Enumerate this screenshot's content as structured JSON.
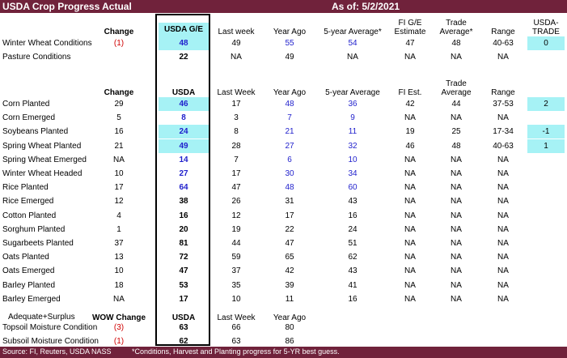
{
  "title": "USDA Crop Progress Actual",
  "as_of": "As of:   5/2/2021",
  "footer": {
    "source": "Source: FI, Reuters, USDA NASS",
    "note": "*Conditions, Harvest and Planting progress for 5-YR best guess."
  },
  "colors": {
    "header_bg": "#70223b",
    "highlight": "#a6f2f5",
    "blue": "#1f1fcc",
    "red": "#d00000"
  },
  "section1": {
    "headers": {
      "change": "Change",
      "usda": "USDA G/E",
      "last_week": "Last week",
      "year_ago": "Year Ago",
      "five_year": "5-year Average*",
      "fi": "FI G/E Estimate",
      "trade": "Trade Average*",
      "range": "Range",
      "usda_trade": "USDA-TRADE"
    },
    "rows": [
      {
        "label": "Winter Wheat Conditions",
        "change": "(1)",
        "usda": "48",
        "last_week": "49",
        "year_ago": "55",
        "five_year": "54",
        "fi": "47",
        "trade": "48",
        "range": "40-63",
        "usda_trade": "0"
      },
      {
        "label": "Pasture Conditions",
        "change": "",
        "usda": "22",
        "last_week": "NA",
        "year_ago": "49",
        "five_year": "NA",
        "fi": "NA",
        "trade": "NA",
        "range": "NA",
        "usda_trade": ""
      }
    ]
  },
  "section2": {
    "headers": {
      "change": "Change",
      "usda": "USDA",
      "last_week": "Last Week",
      "year_ago": "Year Ago",
      "five_year": "5-year Average",
      "fi": "FI Est.",
      "trade": "Trade Average",
      "range": "Range"
    },
    "rows": [
      {
        "label": "Corn Planted",
        "change": "29",
        "usda": "46",
        "last_week": "17",
        "year_ago": "48",
        "five_year": "36",
        "fi": "42",
        "trade": "44",
        "range": "37-53",
        "usda_trade": "2"
      },
      {
        "label": "Corn Emerged",
        "change": "5",
        "usda": "8",
        "last_week": "3",
        "year_ago": "7",
        "five_year": "9",
        "fi": "NA",
        "trade": "NA",
        "range": "NA",
        "usda_trade": ""
      },
      {
        "label": "Soybeans Planted",
        "change": "16",
        "usda": "24",
        "last_week": "8",
        "year_ago": "21",
        "five_year": "11",
        "fi": "19",
        "trade": "25",
        "range": "17-34",
        "usda_trade": "-1"
      },
      {
        "label": "Spring Wheat Planted",
        "change": "21",
        "usda": "49",
        "last_week": "28",
        "year_ago": "27",
        "five_year": "32",
        "fi": "46",
        "trade": "48",
        "range": "40-63",
        "usda_trade": "1"
      },
      {
        "label": "Spring Wheat Emerged",
        "change": "NA",
        "usda": "14",
        "last_week": "7",
        "year_ago": "6",
        "five_year": "10",
        "fi": "NA",
        "trade": "NA",
        "range": "NA",
        "usda_trade": ""
      },
      {
        "label": "Winter Wheat Headed",
        "change": "10",
        "usda": "27",
        "last_week": "17",
        "year_ago": "30",
        "five_year": "34",
        "fi": "NA",
        "trade": "NA",
        "range": "NA",
        "usda_trade": ""
      },
      {
        "label": "Rice Planted",
        "change": "17",
        "usda": "64",
        "last_week": "47",
        "year_ago": "48",
        "five_year": "60",
        "fi": "NA",
        "trade": "NA",
        "range": "NA",
        "usda_trade": ""
      },
      {
        "label": "Rice Emerged",
        "change": "12",
        "usda": "38",
        "last_week": "26",
        "year_ago": "31",
        "five_year": "43",
        "fi": "NA",
        "trade": "NA",
        "range": "NA",
        "usda_trade": ""
      },
      {
        "label": "Cotton Planted",
        "change": "4",
        "usda": "16",
        "last_week": "12",
        "year_ago": "17",
        "five_year": "16",
        "fi": "NA",
        "trade": "NA",
        "range": "NA",
        "usda_trade": ""
      },
      {
        "label": "Sorghum Planted",
        "change": "1",
        "usda": "20",
        "last_week": "19",
        "year_ago": "22",
        "five_year": "24",
        "fi": "NA",
        "trade": "NA",
        "range": "NA",
        "usda_trade": ""
      },
      {
        "label": "Sugarbeets Planted",
        "change": "37",
        "usda": "81",
        "last_week": "44",
        "year_ago": "47",
        "five_year": "51",
        "fi": "NA",
        "trade": "NA",
        "range": "NA",
        "usda_trade": ""
      },
      {
        "label": "Oats Planted",
        "change": "13",
        "usda": "72",
        "last_week": "59",
        "year_ago": "65",
        "five_year": "62",
        "fi": "NA",
        "trade": "NA",
        "range": "NA",
        "usda_trade": ""
      },
      {
        "label": "Oats Emerged",
        "change": "10",
        "usda": "47",
        "last_week": "37",
        "year_ago": "42",
        "five_year": "43",
        "fi": "NA",
        "trade": "NA",
        "range": "NA",
        "usda_trade": ""
      },
      {
        "label": "Barley Planted",
        "change": "18",
        "usda": "53",
        "last_week": "35",
        "year_ago": "39",
        "five_year": "41",
        "fi": "NA",
        "trade": "NA",
        "range": "NA",
        "usda_trade": ""
      },
      {
        "label": "Barley Emerged",
        "change": "NA",
        "usda": "17",
        "last_week": "10",
        "year_ago": "11",
        "five_year": "16",
        "fi": "NA",
        "trade": "NA",
        "range": "NA",
        "usda_trade": ""
      }
    ]
  },
  "section3": {
    "headers": {
      "label": "Adequate+Surplus",
      "change": "WOW Change",
      "usda": "USDA",
      "last_week": "Last Week",
      "year_ago": "Year Ago"
    },
    "rows": [
      {
        "label": "Topsoil Moisture Condition",
        "change": "(3)",
        "usda": "63",
        "last_week": "66",
        "year_ago": "80"
      },
      {
        "label": "Subsoil Moisture Condition",
        "change": "(1)",
        "usda": "62",
        "last_week": "63",
        "year_ago": "86"
      }
    ]
  }
}
